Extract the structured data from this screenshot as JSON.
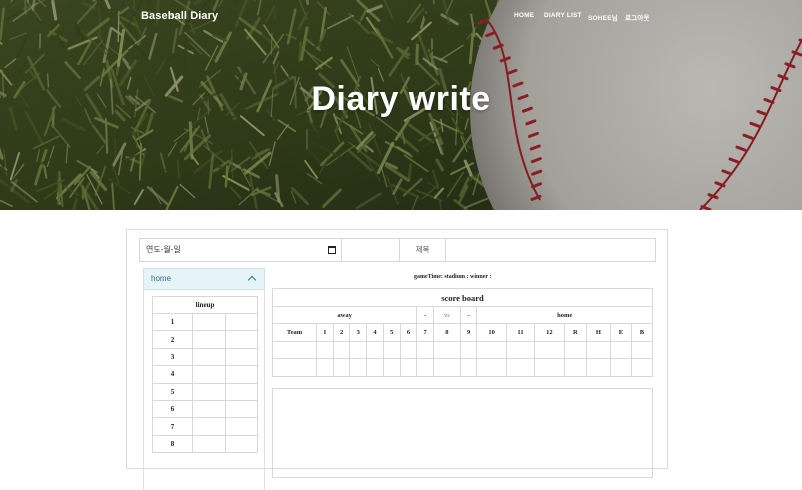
{
  "header": {
    "brand": "Baseball Diary",
    "nav": [
      "HOME",
      "DIARY LIST",
      "SOHEE님",
      "로그아웃"
    ],
    "title": "Diary write"
  },
  "form": {
    "date_placeholder": "연도-월-일",
    "title_label": "제목"
  },
  "sidebar": {
    "accordion_label": "home",
    "lineup_title": "lineup",
    "lineup_numbers": [
      "1",
      "2",
      "3",
      "4",
      "5",
      "6",
      "7",
      "8"
    ]
  },
  "game_info": "gameTime:   stadium :   winner :",
  "scoreboard": {
    "title": "score board",
    "away_label": "away",
    "away_score": "-",
    "vs_label": "vs",
    "home_score": "-",
    "home_label": "home",
    "columns": [
      "Team",
      "1",
      "2",
      "3",
      "4",
      "5",
      "6",
      "7",
      "8",
      "9",
      "10",
      "11",
      "12",
      "R",
      "H",
      "E",
      "B"
    ]
  },
  "colors": {
    "accordion_bg": "#e6f3f8",
    "accordion_text": "#2d6f8e"
  }
}
